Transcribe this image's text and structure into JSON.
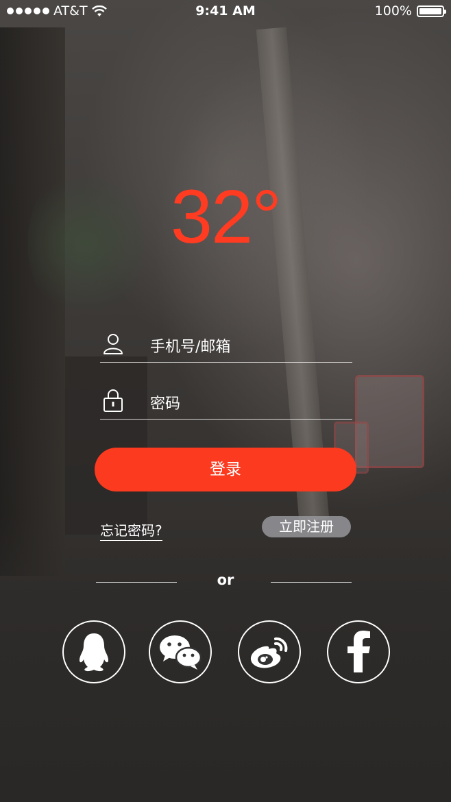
{
  "status_bar": {
    "carrier": "AT&T",
    "time": "9:41 AM",
    "battery": "100%"
  },
  "weather": {
    "temperature": "32°"
  },
  "form": {
    "username_placeholder": "手机号/邮箱",
    "password_placeholder": "密码",
    "login_label": "登录",
    "forgot_label": "忘记密码?",
    "register_label": "立即注册"
  },
  "divider": {
    "text": "or"
  },
  "social_logins": [
    {
      "icon": "qq-icon"
    },
    {
      "icon": "wechat-icon"
    },
    {
      "icon": "weibo-icon"
    },
    {
      "icon": "facebook-icon"
    }
  ],
  "colors": {
    "accent": "#fb3a1f",
    "temperature": "#ff3b22",
    "register_bg": "#96969b"
  }
}
